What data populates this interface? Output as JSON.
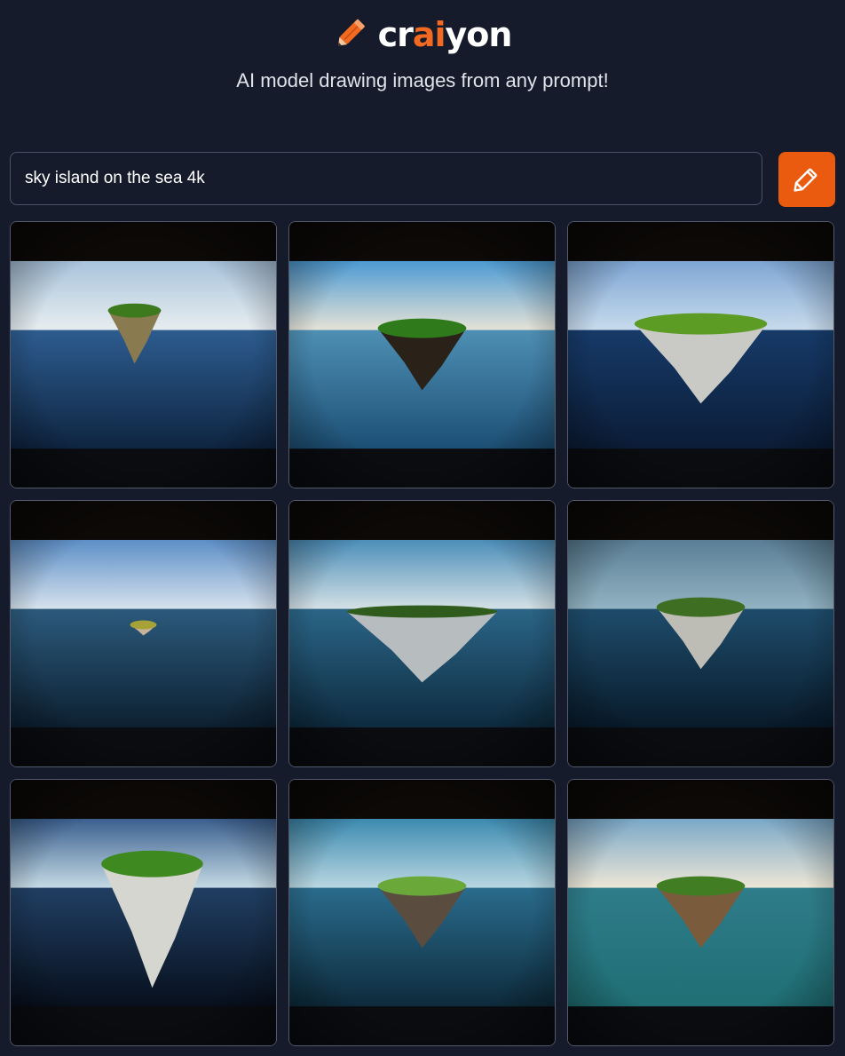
{
  "brand": {
    "prefix": "cr",
    "highlight": "ai",
    "suffix": "yon",
    "accent": "#f26a21"
  },
  "tagline": "AI model drawing images from any prompt!",
  "prompt": {
    "value": "sky island on the sea 4k"
  },
  "draw_button": {
    "icon": "pencil-icon",
    "color": "#ea5b10"
  },
  "images": [
    {
      "sky_top": "#a9c4dc",
      "sky_bottom": "#e8eef0",
      "sea_top": "#2d5c8f",
      "sea_bottom": "#0e2440",
      "grass": "#3d7a1e",
      "rock": "#8a7a50",
      "island_size": "small"
    },
    {
      "sky_top": "#4c9ad3",
      "sky_bottom": "#e9e4d6",
      "sea_top": "#4e8fb4",
      "sea_bottom": "#1c4e74",
      "grass": "#2f7a1a",
      "rock": "#2a2118",
      "island_size": "medium"
    },
    {
      "sky_top": "#7ea6d4",
      "sky_bottom": "#c9dcec",
      "sea_top": "#163a68",
      "sea_bottom": "#0b1c36",
      "grass": "#5c9b24",
      "rock": "#c9cac6",
      "island_size": "large"
    },
    {
      "sky_top": "#5d8fc7",
      "sky_bottom": "#d9e4ee",
      "sea_top": "#2c5a7c",
      "sea_bottom": "#0c1f30",
      "grass": "#a6a238",
      "rock": "#c6b59a",
      "island_size": "tiny"
    },
    {
      "sky_top": "#4c8eb9",
      "sky_bottom": "#d6e2e6",
      "sea_top": "#2b6587",
      "sea_bottom": "#0d2a3e",
      "grass": "#2f5c1c",
      "rock": "#b7bcbf",
      "island_size": "wide"
    },
    {
      "sky_top": "#5a7e95",
      "sky_bottom": "#93b4c3",
      "sea_top": "#1e4c6b",
      "sea_bottom": "#081a2a",
      "grass": "#3d6e22",
      "rock": "#bdbcb5",
      "island_size": "medium"
    },
    {
      "sky_top": "#3a5f8f",
      "sky_bottom": "#c8dde6",
      "sea_top": "#203e62",
      "sea_bottom": "#070f1c",
      "grass": "#3f8a20",
      "rock": "#d6d6d0",
      "island_size": "tall"
    },
    {
      "sky_top": "#3c8ab0",
      "sky_bottom": "#bcd9e2",
      "sea_top": "#2a6b8c",
      "sea_bottom": "#0d2a3b",
      "grass": "#6aa83a",
      "rock": "#5a4d40",
      "island_size": "medium"
    },
    {
      "sky_top": "#7aa8c8",
      "sky_bottom": "#efe8d6",
      "sea_top": "#2f7c8a",
      "sea_bottom": "#1f6f74",
      "grass": "#417d22",
      "rock": "#7a5c3c",
      "island_size": "medium"
    }
  ]
}
